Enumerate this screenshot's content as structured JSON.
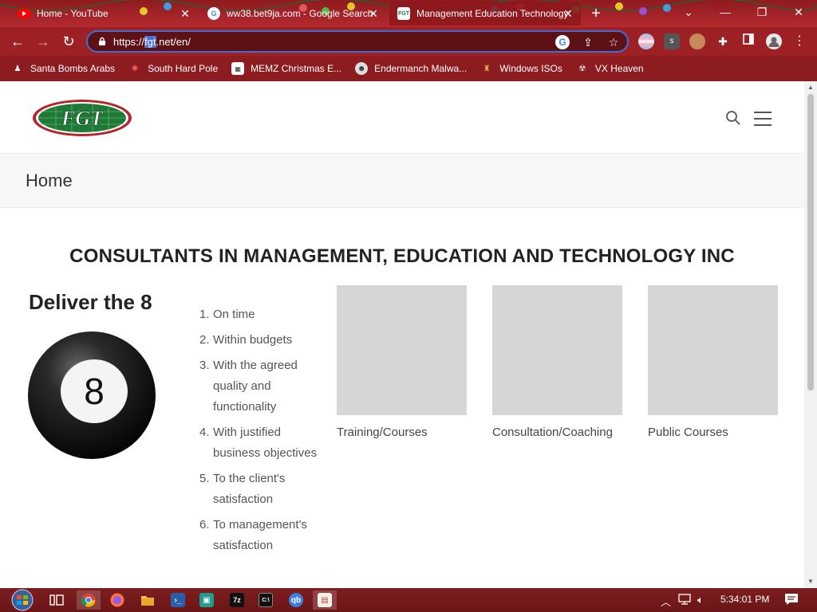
{
  "browser": {
    "tabs": [
      {
        "title": "Home - YouTube",
        "favicon": "youtube-icon",
        "active": false
      },
      {
        "title": "ww38.bet9ja.com - Google Search",
        "favicon": "google-icon",
        "active": false
      },
      {
        "title": "Management Education Technology",
        "favicon": "fgt-icon",
        "active": true
      }
    ],
    "new_tab": "+",
    "window_controls": {
      "dropdown": "⌄",
      "minimize": "—",
      "restore": "❐",
      "close": "✕"
    },
    "url": {
      "prefix": "https://",
      "host_selected": "fgt",
      "rest": ".net/en/"
    },
    "bookmarks": [
      {
        "label": "Santa Bombs Arabs",
        "icon": "santa-icon"
      },
      {
        "label": "South Hard Pole",
        "icon": "snowflake-icon"
      },
      {
        "label": "MEMZ Christmas E...",
        "icon": "memz-icon"
      },
      {
        "label": "Endermanch Malwa...",
        "icon": "endermanch-icon"
      },
      {
        "label": "Windows ISOs",
        "icon": "windows-iso-icon"
      },
      {
        "label": "VX Heaven",
        "icon": "vx-icon"
      }
    ],
    "ext_badge": "s"
  },
  "site": {
    "logo_text": "FGT",
    "page_title": "Home",
    "company_heading": "CONSULTANTS IN MANAGEMENT, EDUCATION AND TECHNOLOGY INC",
    "deliver_heading": "Deliver the 8",
    "ball_number": "8",
    "deliverables": [
      {
        "num": "1.",
        "text": "On time"
      },
      {
        "num": "2.",
        "text": "Within budgets"
      },
      {
        "num": "3.",
        "text": "With the agreed quality and functionality"
      },
      {
        "num": "4.",
        "text": "With justified business objectives"
      },
      {
        "num": "5.",
        "text": "To the client's satisfaction"
      },
      {
        "num": "6.",
        "text": "To management's satisfaction"
      }
    ],
    "cards": [
      {
        "caption": "Training/Courses"
      },
      {
        "caption": "Consultation/Coaching"
      },
      {
        "caption": "Public Courses"
      }
    ]
  },
  "taskbar": {
    "time": "5:34:01 PM",
    "apps": [
      "task-view-icon",
      "chrome-icon",
      "firefox-icon",
      "file-explorer-icon",
      "powershell-icon",
      "app-icon",
      "7zip-icon",
      "cmd-icon",
      "qbittorrent-icon",
      "app2-icon"
    ],
    "sevenzip_label": "7z",
    "cmd_label": "C:\\"
  },
  "colors": {
    "chrome_red": "#9d2025",
    "tab_bar_red": "#a32328",
    "logo_green": "#1e7a36",
    "logo_red": "#b3262b",
    "taskbar_red": "#7c1d1f"
  }
}
